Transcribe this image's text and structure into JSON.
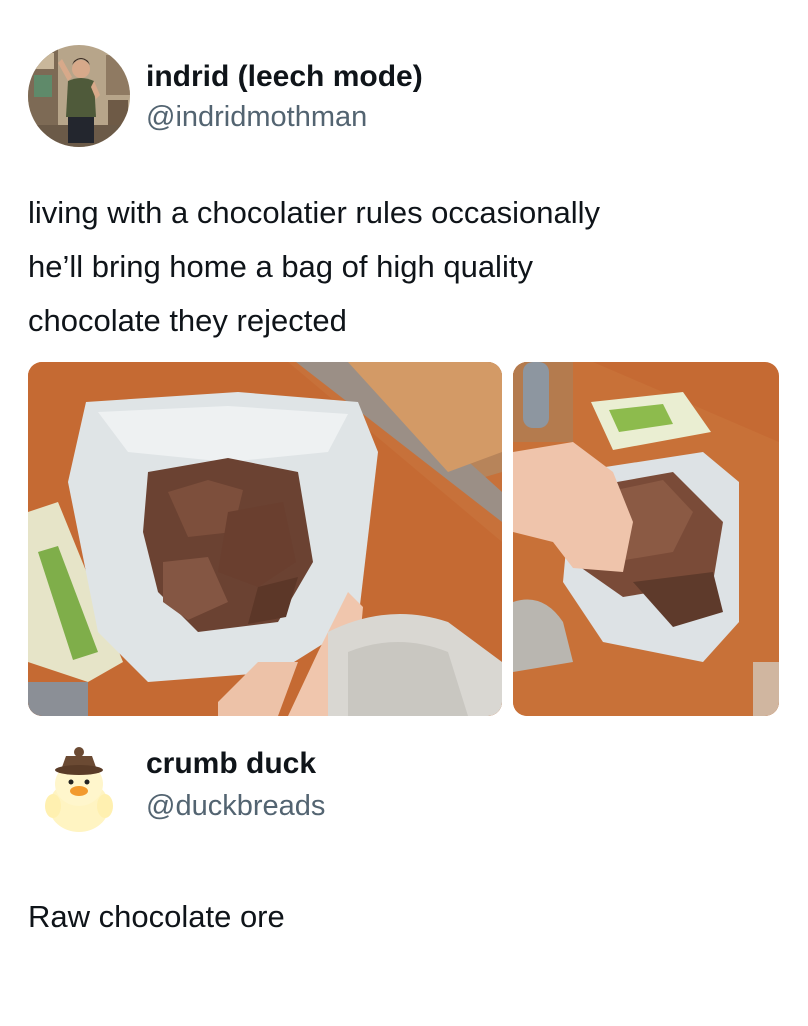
{
  "tweet": {
    "author": {
      "display_name": "indrid (leech mode)",
      "handle": "@indridmothman"
    },
    "text_lines": [
      "living with a chocolatier rules occasionally",
      "he’ll bring home a bag of high quality",
      "chocolate they rejected"
    ],
    "media": [
      {
        "icon": "photo-open-bag-of-chocolate"
      },
      {
        "icon": "photo-hand-holding-chocolate-chunk"
      }
    ]
  },
  "reply": {
    "author": {
      "display_name": "crumb duck",
      "handle": "@duckbreads"
    },
    "text": "Raw chocolate ore"
  },
  "colors": {
    "text_primary": "#0f1419",
    "text_secondary": "#536471",
    "background": "#ffffff"
  }
}
